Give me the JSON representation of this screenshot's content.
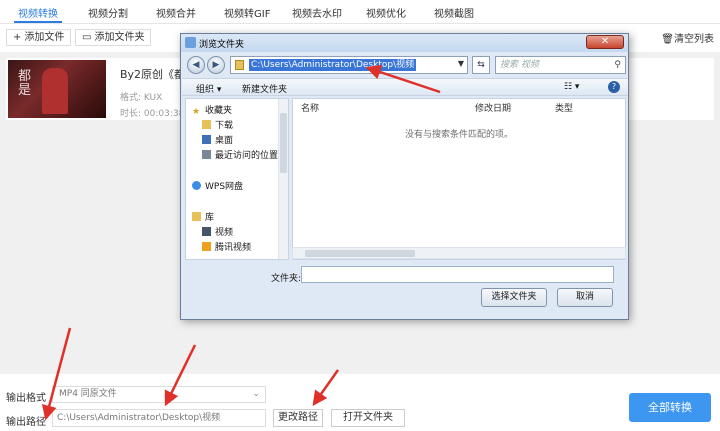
{
  "tabs": [
    "视频转换",
    "视频分割",
    "视频合并",
    "视频转GIF",
    "视频去水印",
    "视频优化",
    "视频截图"
  ],
  "toolbar": {
    "add_file": "添加文件",
    "add_folder": "添加文件夹",
    "clear_list": "清空列表"
  },
  "file": {
    "title": "By2原创《都是",
    "format": "格式: KUX",
    "duration": "时长: 00:03:38",
    "thumb_text": "都\n是"
  },
  "dialog": {
    "title": "浏览文件夹",
    "close": "✕",
    "path": "C:\\Users\\Administrator\\Desktop\\视频",
    "search_placeholder": "搜索 视频",
    "organize": "组织 ▾",
    "new_folder": "新建文件夹",
    "nav": {
      "favorites": "收藏夹",
      "downloads": "下载",
      "desktop": "桌面",
      "recent": "最近访问的位置",
      "wps": "WPS网盘",
      "library": "库",
      "video": "视频",
      "tencent_video": "腾讯视频"
    },
    "columns": {
      "name": "名称",
      "modified": "修改日期",
      "type": "类型"
    },
    "empty": "没有与搜索条件匹配的项。",
    "folder_label": "文件夹:",
    "select_btn": "选择文件夹",
    "cancel_btn": "取消"
  },
  "bottom": {
    "output_format_label": "输出格式",
    "output_format_value": "MP4  同原文件",
    "output_path_label": "输出路径",
    "output_path_value": "C:\\Users\\Administrator\\Desktop\\视频",
    "change_path": "更改路径",
    "open_folder": "打开文件夹",
    "convert_all": "全部转换"
  },
  "colors": {
    "accent": "#2b7de0",
    "convert_btn": "#3d97f0",
    "arrow": "#e0302a"
  }
}
